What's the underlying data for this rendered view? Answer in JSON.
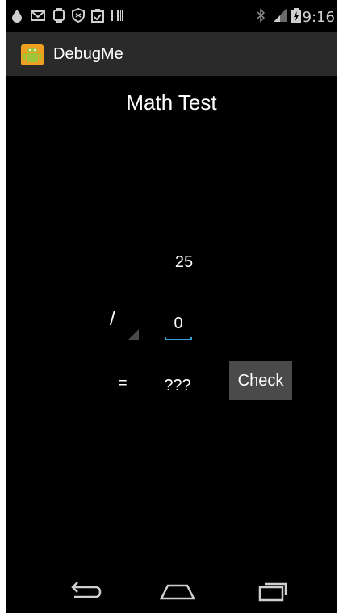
{
  "status_bar": {
    "time": "9:16",
    "left_icons": [
      "drop-icon",
      "mail-icon",
      "watch-icon",
      "shield-icon",
      "clipboard-icon",
      "barcode-icon"
    ],
    "right_icons": [
      "bluetooth-icon",
      "signal-icon",
      "battery-icon"
    ]
  },
  "action_bar": {
    "app_title": "DebugMe",
    "app_icon": "android-icon"
  },
  "main": {
    "title": "Math Test",
    "operand1": "25",
    "operator": "/",
    "operand2": "0",
    "equals": "=",
    "result": "???",
    "check_label": "Check"
  },
  "nav_bar": {
    "buttons": [
      "back-icon",
      "home-icon",
      "recents-icon"
    ]
  },
  "colors": {
    "background": "#000000",
    "action_bar": "#2a2a2a",
    "accent": "#33a3d6",
    "button": "#4a4a4a"
  }
}
